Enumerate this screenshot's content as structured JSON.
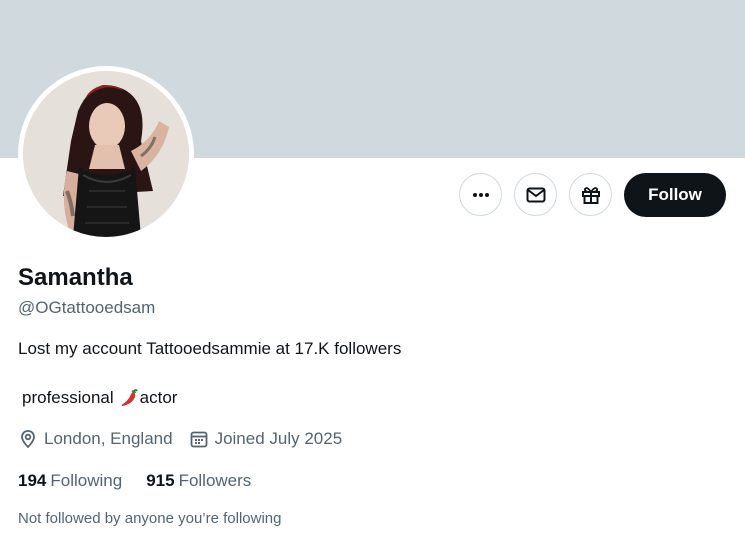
{
  "profile": {
    "display_name": "Samantha",
    "handle": "@OGtattooedsam",
    "bio_line1": "Lost my account Tattooedsammie at 17.K followers",
    "bio_line2_pre": "professional",
    "bio_line2_emoji": "chili-pepper",
    "bio_line2_post": "actor",
    "location": "London, England",
    "joined": "Joined July 2025",
    "following_count": "194",
    "following_label": "Following",
    "followers_count": "915",
    "followers_label": "Followers",
    "not_followed_note": "Not followed by anyone you’re following"
  },
  "actions": {
    "more_icon": "more-horizontal-icon",
    "message_icon": "envelope-icon",
    "gift_icon": "gift-icon",
    "follow_label": "Follow"
  },
  "colors": {
    "banner": "#cfd9de",
    "primary_text": "#0f1419",
    "secondary_text": "#536471",
    "button_dark": "#0f1419"
  }
}
